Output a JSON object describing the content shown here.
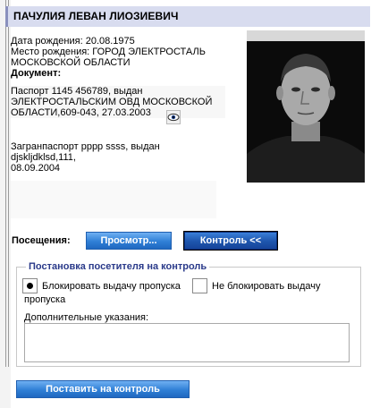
{
  "person": {
    "full_name": "ПАЧУЛИЯ ЛЕВАН ЛИОЗИЕВИЧ",
    "birth_date_line": "Дата рождения: 20.08.1975",
    "birth_place_line1": "Место рождения: ГОРОД ЭЛЕКТРОСТАЛЬ",
    "birth_place_line2": "МОСКОВСКОЙ ОБЛАСТИ",
    "document_label": "Документ:",
    "passport_line1": "Паспорт 1145 456789, выдан",
    "passport_line2": "ЭЛЕКТРОСТАЛЬСКИМ ОВД МОСКОВСКОЙ",
    "passport_line3": "ОБЛАСТИ,609-043,  27.03.2003",
    "foreign_passport_line1": "Загранпаспорт pppp ssss, выдан djsklјdklsd,111,",
    "foreign_passport_line2": "08.09.2004"
  },
  "visits": {
    "label": "Посещения:",
    "view_button": "Просмотр...",
    "control_button": "Контроль <<"
  },
  "control_form": {
    "legend": "Постановка посетителя на контроль",
    "option_block": "Блокировать выдачу пропуска",
    "option_no_block_line1": "Не блокировать выдачу",
    "option_no_block_line2": "пропуска",
    "selected_option": "block",
    "extra_label": "Дополнительные указания:",
    "extra_value": "",
    "submit_button": "Поставить на контроль"
  },
  "icons": {
    "view_document": "eye-icon"
  }
}
